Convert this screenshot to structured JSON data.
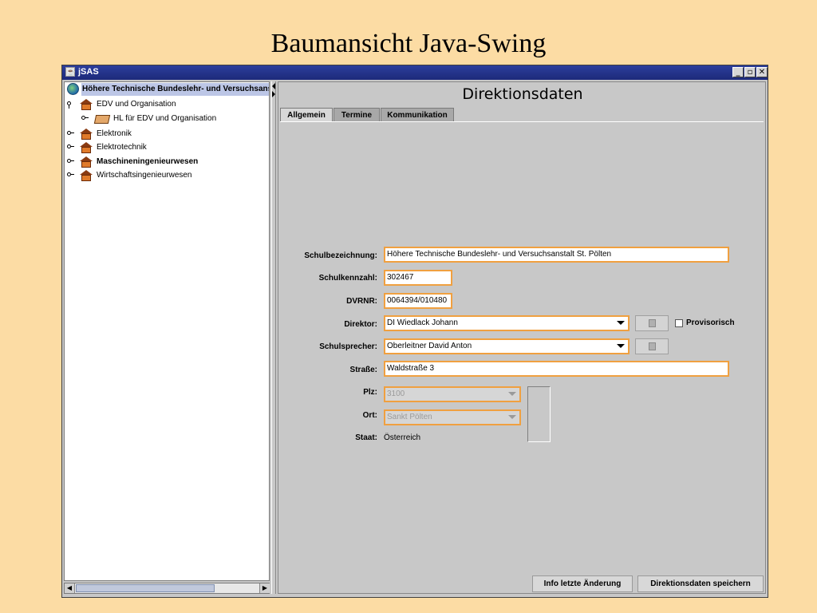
{
  "slide_title": "Baumansicht Java-Swing",
  "window": {
    "title": "jSAS",
    "buttons": {
      "minimize": "_",
      "maximize": "▫",
      "close": "✕"
    }
  },
  "tree": {
    "root": "Höhere Technische Bundeslehr- und Versuchsanstalt",
    "items": [
      {
        "label": "EDV und Organisation"
      },
      {
        "label": "HL für EDV und Organisation"
      },
      {
        "label": "Elektronik"
      },
      {
        "label": "Elektrotechnik"
      },
      {
        "label": "Maschineningenieurwesen"
      },
      {
        "label": "Wirtschaftsingenieurwesen"
      }
    ]
  },
  "panel": {
    "title": "Direktionsdaten",
    "tabs": [
      "Allgemein",
      "Termine",
      "Kommunikation"
    ],
    "active_tab": "Allgemein"
  },
  "form": {
    "schulbezeichnung": {
      "label": "Schulbezeichnung:",
      "value": "Höhere Technische Bundeslehr- und Versuchsanstalt St. Pölten"
    },
    "schulkennzahl": {
      "label": "Schulkennzahl:",
      "value": "302467"
    },
    "dvrnr": {
      "label": "DVRNR:",
      "value": "0064394/010480"
    },
    "direktor": {
      "label": "Direktor:",
      "value": "DI Wiedlack Johann"
    },
    "provisorisch": {
      "label": "Provisorisch",
      "checked": false
    },
    "schulsprecher": {
      "label": "Schulsprecher:",
      "value": "Oberleitner David Anton"
    },
    "strasse": {
      "label": "Straße:",
      "value": "Waldstraße 3"
    },
    "plz": {
      "label": "Plz:",
      "value": "3100"
    },
    "ort": {
      "label": "Ort:",
      "value": "Sankt Pölten"
    },
    "staat": {
      "label": "Staat:",
      "value": "Österreich"
    }
  },
  "buttons": {
    "info": "Info letzte Änderung",
    "save": "Direktionsdaten speichern"
  },
  "colors": {
    "background": "#fcdca4",
    "titlebar": "#1d2a7a",
    "field_border": "#f0a040"
  }
}
